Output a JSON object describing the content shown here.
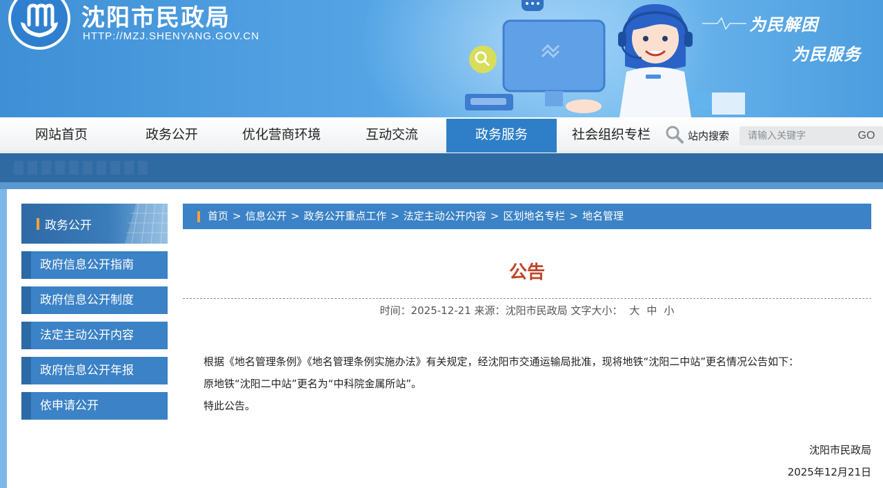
{
  "header": {
    "site_name": "沈阳市民政局",
    "site_url": "HTTP://MZJ.SHENYANG.GOV.CN",
    "slogans": [
      "为民解困",
      "为民服务"
    ]
  },
  "nav": {
    "items": [
      "网站首页",
      "政务公开",
      "优化营商环境",
      "互动交流",
      "政务服务",
      "社会组织专栏"
    ],
    "active_index": 4,
    "search_label": "站内搜索",
    "search_placeholder": "请输入关键字",
    "search_button": "GO"
  },
  "sidebar": {
    "heading": "政务公开",
    "items": [
      "政府信息公开指南",
      "政府信息公开制度",
      "法定主动公开内容",
      "政府信息公开年报",
      "依申请公开"
    ]
  },
  "breadcrumb": {
    "items": [
      "首页",
      "信息公开",
      "政务公开重点工作",
      "法定主动公开内容",
      "区划地名专栏",
      "地名管理"
    ],
    "separator": ">"
  },
  "article": {
    "title": "公告",
    "time_label": "时间：",
    "time": "2025-12-21",
    "source_label": "来源：",
    "source": "沈阳市民政局",
    "font_size_label": "文字大小：",
    "font_sizes": [
      "大",
      "中",
      "小"
    ],
    "paragraphs": [
      "根据《地名管理条例》《地名管理条例实施办法》有关规定，经沈阳市交通运输局批准，现将地铁“沈阳二中站”更名情况公告如下：",
      "原地铁“沈阳二中站”更名为“中科院金属所站”。",
      "特此公告。"
    ],
    "signature": "沈阳市民政局",
    "date": "2025年12月21日"
  },
  "colors": {
    "banner": "#4c9ddf",
    "nav_active": "#2f7fc8",
    "sidebar_item": "#3b82c6",
    "accent_bar": "#f2a23a",
    "title": "#c0452b"
  },
  "icons": {
    "logo": "hands-logo-icon",
    "search": "magnifier-icon"
  }
}
